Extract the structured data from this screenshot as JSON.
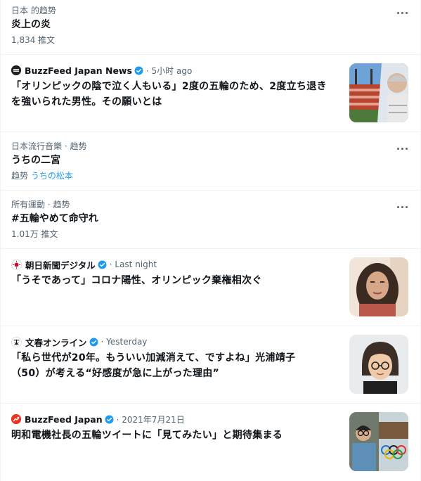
{
  "trends": [
    {
      "meta": "日本 的趋势",
      "title": "炎上の炎",
      "sub": "1,834 推文"
    },
    {
      "meta": "日本流行音樂 · 趋势",
      "title": "うちの二宮",
      "sub_prefix": "趋势",
      "sub_link": "うちの松本"
    },
    {
      "meta": "所有運動 · 趋势",
      "title": "#五輪やめて命守れ",
      "sub": "1.01万 推文"
    }
  ],
  "news": [
    {
      "source": "BuzzFeed Japan News",
      "time": "· 5小时 ago",
      "headline_line1": "「オリンピックの陰で泣く人もいる」2度の五輪のため、2度立ち退き",
      "headline_line2": "を強いられた男性。その願いとは",
      "avatar_icon": "buzzfeed-news-logo",
      "thumb_icon": "stadium-and-elderly-man-photo"
    },
    {
      "source": "朝日新聞デジタル",
      "time": "· Last night",
      "headline_line1": "「うそであって」コロナ陽性、オリンピック棄権相次ぐ",
      "headline_line2": "",
      "avatar_icon": "asahi-logo",
      "thumb_icon": "woman-video-call-photo"
    },
    {
      "source": "文春オンライン",
      "time": "· Yesterday",
      "headline_line1": "「私ら世代が20年。もういい加減消えて、ですよね」光浦靖子",
      "headline_line2": "（50）が考える“好感度が急に上がった理由”",
      "avatar_icon": "bunshun-logo",
      "thumb_icon": "woman-with-glasses-photo"
    },
    {
      "source": "BuzzFeed Japan",
      "time": "· 2021年7月21日",
      "headline_line1": "明和電機社長の五輪ツイートに「見てみたい」と期待集まる",
      "headline_line2": "",
      "avatar_icon": "buzzfeed-logo",
      "thumb_icon": "man-and-olympic-rings-photo"
    }
  ],
  "colors": {
    "accent": "#1d9bf0",
    "text": "#0f1419",
    "secondary": "#536471"
  }
}
